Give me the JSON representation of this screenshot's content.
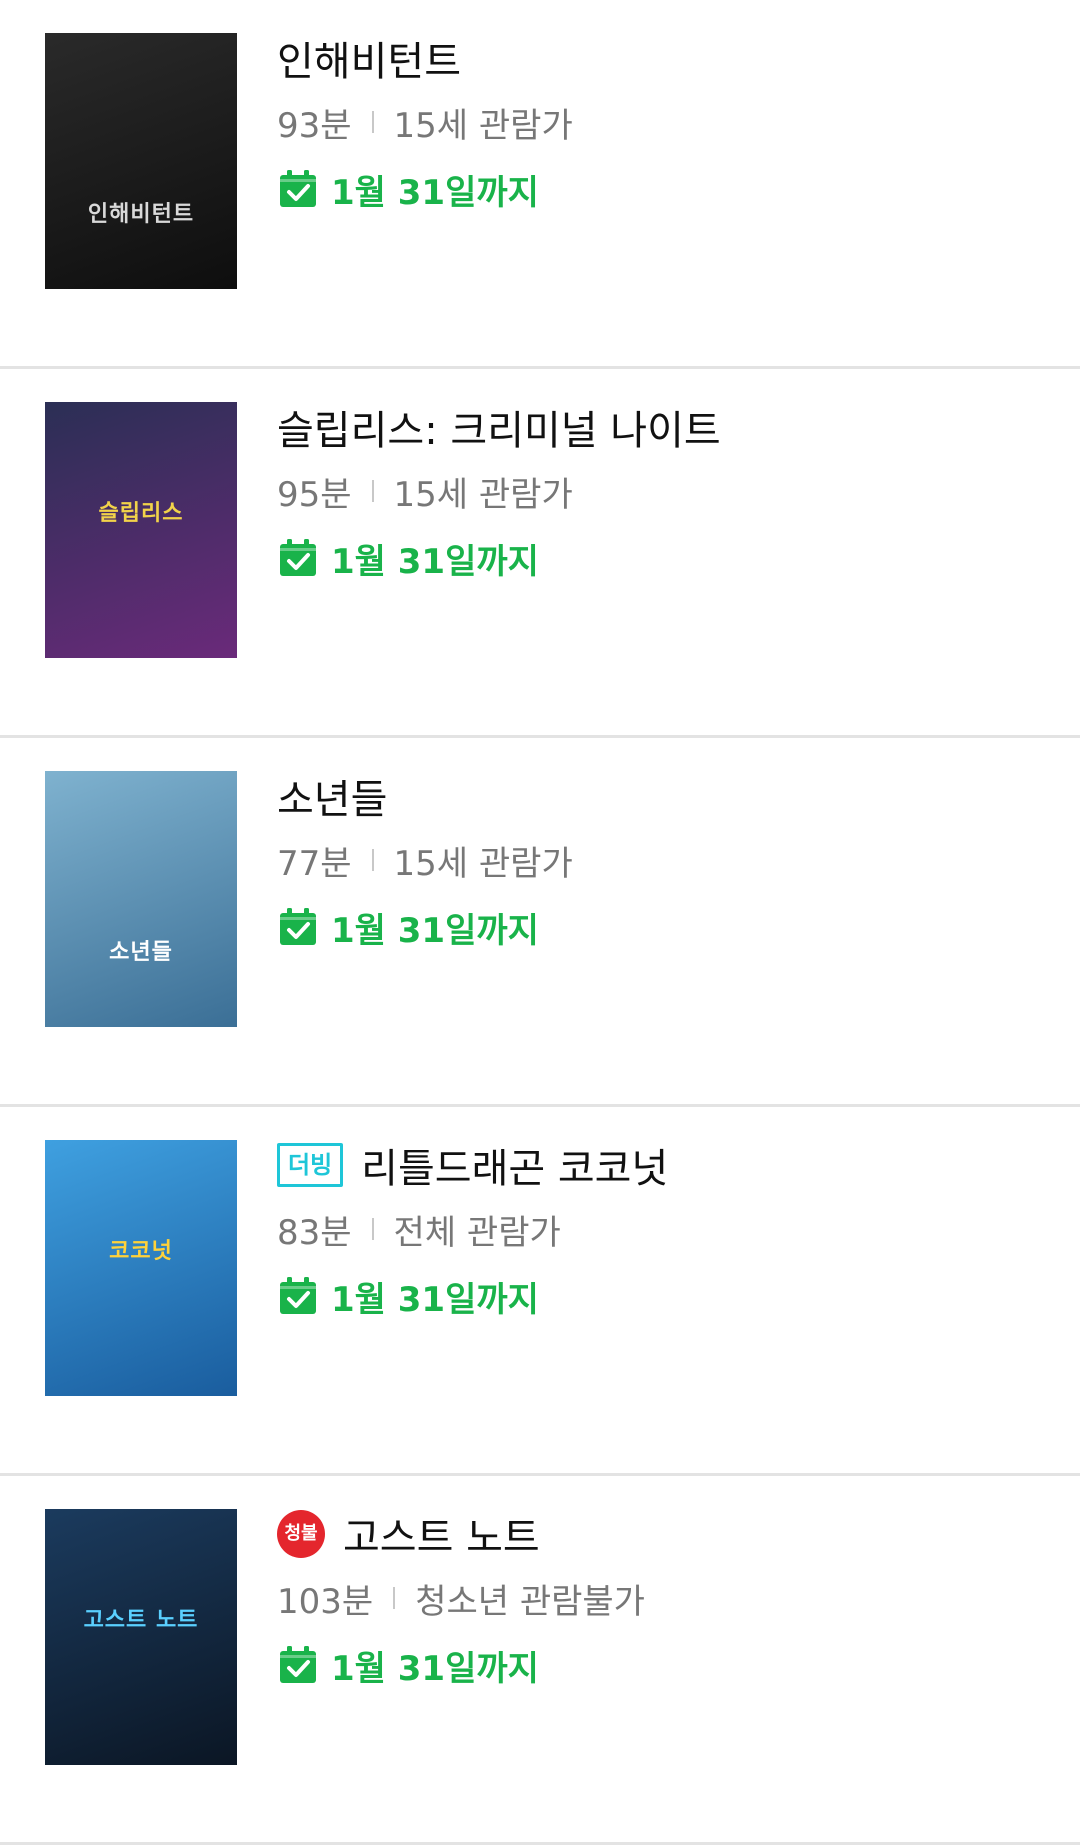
{
  "movies": [
    {
      "title": "인해비턴트",
      "runtime": "93분",
      "rating": "15세 관람가",
      "until": "1월 31일까지",
      "badge": null,
      "poster": {
        "text": "인해비턴트",
        "bg1": "#2a2a2a",
        "bg2": "#0e0e0e",
        "fg": "#d9d9d9"
      }
    },
    {
      "title": "슬립리스: 크리미널 나이트",
      "runtime": "95분",
      "rating": "15세 관람가",
      "until": "1월 31일까지",
      "badge": null,
      "poster": {
        "text": "슬립리스",
        "bg1": "#2b2f55",
        "bg2": "#6a2a7a",
        "fg": "#f2d34a"
      }
    },
    {
      "title": "소년들",
      "runtime": "77분",
      "rating": "15세 관람가",
      "until": "1월 31일까지",
      "badge": null,
      "poster": {
        "text": "소년들",
        "bg1": "#7fb2cf",
        "bg2": "#3b6f96",
        "fg": "#ffffff"
      }
    },
    {
      "title": "리틀드래곤 코코넛",
      "runtime": "83분",
      "rating": "전체 관람가",
      "until": "1월 31일까지",
      "badge": {
        "type": "dub",
        "label": "더빙"
      },
      "poster": {
        "text": "코코넛",
        "bg1": "#3fa0e0",
        "bg2": "#1a5d9e",
        "fg": "#ffd23a"
      }
    },
    {
      "title": "고스트 노트",
      "runtime": "103분",
      "rating": "청소년 관람불가",
      "until": "1월 31일까지",
      "badge": {
        "type": "rating",
        "label": "청불"
      },
      "poster": {
        "text": "고스트 노트",
        "bg1": "#1b3b5e",
        "bg2": "#0b1624",
        "fg": "#5ad0ff"
      }
    }
  ],
  "colors": {
    "accent_green": "#19b34a",
    "dub_cyan": "#1ec6d8",
    "adult_red": "#e4262d",
    "meta_gray": "#777777",
    "divider": "#e3e3e3"
  },
  "icons": {
    "calendar": "calendar-check-icon"
  }
}
